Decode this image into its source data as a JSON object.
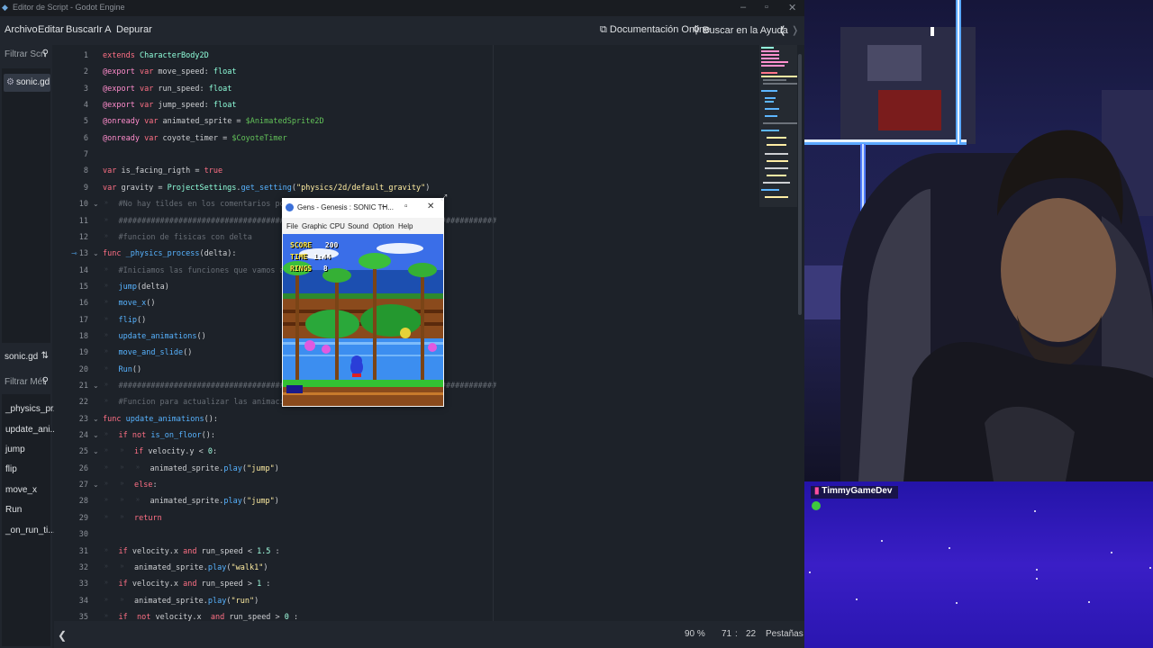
{
  "window": {
    "title": "Editor de Script - Godot Engine"
  },
  "menu": {
    "items": [
      "Archivo",
      "Editar",
      "Buscar",
      "Ir A",
      "Depurar"
    ],
    "online_docs": "Documentación Online",
    "search_help": "Buscar en la Ayuda"
  },
  "left_panel": {
    "filter_scripts": "Filtrar Scri",
    "open_file": "sonic.gd",
    "current_file": "sonic.gd",
    "filter_methods": "Filtrar Mét",
    "methods": [
      "_physics_pr...",
      "update_ani...",
      "jump",
      "flip",
      "move_x",
      "Run",
      "_on_run_ti..."
    ]
  },
  "code_lines": [
    {
      "n": "1",
      "t": "extends CharacterBody2D"
    },
    {
      "n": "2",
      "t": "@export var move_speed: float"
    },
    {
      "n": "3",
      "t": "@export var run_speed: float"
    },
    {
      "n": "4",
      "t": "@export var jump_speed: float"
    },
    {
      "n": "5",
      "t": "@onready var animated_sprite = $AnimatedSprite2D"
    },
    {
      "n": "6",
      "t": "@onready var coyote_timer = $CoyoteTimer"
    },
    {
      "n": "7",
      "t": ""
    },
    {
      "n": "8",
      "t": "var is_facing_rigth = true"
    },
    {
      "n": "9",
      "t": "var gravity = ProjectSettings.get_setting(\"physics/2d/default_gravity\")"
    },
    {
      "n": "10",
      "t": "#No hay tildes en los comentarios por que"
    },
    {
      "n": "11",
      "t": "##################################################################################"
    },
    {
      "n": "12",
      "t": "#funcion de fisicas con delta"
    },
    {
      "n": "13",
      "t": "func _physics_process(delta):"
    },
    {
      "n": "14",
      "t": "#Iniciamos las funciones que vamos a usar"
    },
    {
      "n": "15",
      "t": "jump(delta)"
    },
    {
      "n": "16",
      "t": "move_x()"
    },
    {
      "n": "17",
      "t": "flip()"
    },
    {
      "n": "18",
      "t": "update_animations()"
    },
    {
      "n": "19",
      "t": "move_and_slide()"
    },
    {
      "n": "20",
      "t": "Run()"
    },
    {
      "n": "21",
      "t": "##################################################################################"
    },
    {
      "n": "22",
      "t": "#Funcion para actualizar las animaciones d"
    },
    {
      "n": "23",
      "t": "func update_animations():"
    },
    {
      "n": "24",
      "t": "if not is_on_floor():"
    },
    {
      "n": "25",
      "t": "if velocity.y < 0:"
    },
    {
      "n": "26",
      "t": "animated_sprite.play(\"jump\")"
    },
    {
      "n": "27",
      "t": "else:"
    },
    {
      "n": "28",
      "t": "animated_sprite.play(\"jump\")"
    },
    {
      "n": "29",
      "t": "return"
    },
    {
      "n": "30",
      "t": ""
    },
    {
      "n": "31",
      "t": "if velocity.x and run_speed < 1.5 :"
    },
    {
      "n": "32",
      "t": "animated_sprite.play(\"walk1\")"
    },
    {
      "n": "33",
      "t": "if velocity.x and run_speed > 1 :"
    },
    {
      "n": "34",
      "t": "animated_sprite.play(\"run\")"
    },
    {
      "n": "35",
      "t": "if  not velocity.x  and run_speed > 0 :"
    }
  ],
  "status": {
    "zoom": "90 %",
    "line": "71",
    "col": "22",
    "indent": "Pestañas"
  },
  "gens": {
    "title": "Gens - Genesis : SONIC TH...",
    "menu": [
      "File",
      "Graphic",
      "CPU",
      "Sound",
      "Option",
      "Help"
    ],
    "hud": {
      "score_label": "SCORE",
      "score": "200",
      "time_label": "TIME",
      "time": "1:44",
      "rings_label": "RINGS",
      "rings": "8"
    }
  },
  "stream": {
    "username": "TimmyGameDev"
  }
}
